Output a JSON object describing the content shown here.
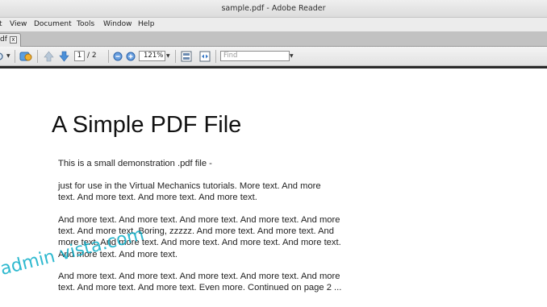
{
  "window": {
    "title": "sample.pdf - Adobe Reader"
  },
  "menu": {
    "file_partial": "t",
    "view": "View",
    "document": "Document",
    "tools": "Tools",
    "window": "Window",
    "help": "Help"
  },
  "tab": {
    "label": "df",
    "close_glyph": "x"
  },
  "toolbar": {
    "current_page": "1",
    "page_total": "/ 2",
    "zoom": "121%",
    "find_placeholder": "Find"
  },
  "document": {
    "title": "A Simple PDF File",
    "paragraphs": [
      [
        "This is a small demonstration .pdf file -"
      ],
      [
        "just for use in the Virtual Mechanics tutorials. More text. And more",
        "text. And more text. And more text. And more text."
      ],
      [
        "And more text. And more text. And more text. And more text. And more",
        "text. And more text. Boring, zzzzz. And more text. And more text. And",
        "more text. And more text. And more text. And more text. And more text.",
        "And more text. And more text."
      ],
      [
        "And more text. And more text. And more text. And more text. And more",
        "text. And more text. And more text. Even more. Continued on page 2 ..."
      ]
    ]
  },
  "watermark": {
    "text": "admin vista.com"
  },
  "colors": {
    "watermark": "#00a9c5",
    "toolbar_arrow": "#4a8fd8"
  }
}
